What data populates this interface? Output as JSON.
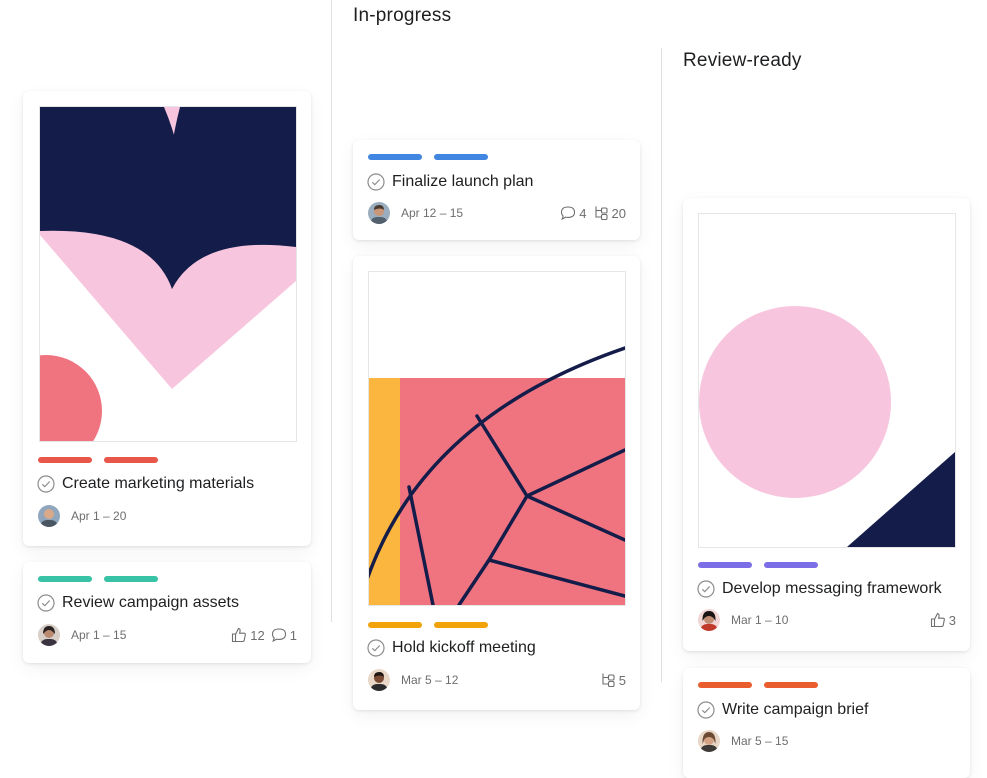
{
  "columns": [
    {
      "title": "In-progress"
    },
    {
      "title": "Review-ready"
    }
  ],
  "cards": [
    {
      "name": "Create marketing materials",
      "date": "Apr 1 – 20",
      "tag_color": "#e8574a"
    },
    {
      "name": "Review campaign assets",
      "date": "Apr 1 – 15",
      "likes": "12",
      "comments": "1",
      "tag_color": "#38c3a6"
    },
    {
      "name": "Finalize launch plan",
      "date": "Apr 12 – 15",
      "comments": "4",
      "subtasks": "20",
      "tag_color": "#4186e0"
    },
    {
      "name": "Hold kickoff meeting",
      "date": "Mar 5 – 12",
      "subtasks": "5",
      "tag_color": "#f2a30a"
    },
    {
      "name": "Develop messaging framework",
      "date": "Mar 1 – 10",
      "likes": "3",
      "tag_color": "#7b6ee6"
    },
    {
      "name": "Write campaign brief",
      "date": "Mar 5 – 15",
      "tag_color": "#ea5d2e"
    }
  ],
  "icons": {
    "check": "check-circle-icon",
    "like": "thumbs-up-icon",
    "comment": "comment-icon",
    "subtask": "subtask-icon"
  },
  "colors": {
    "navy": "#141d4a",
    "pink": "#f7c6de",
    "coral": "#f07480",
    "yellow": "#fbb63f"
  }
}
